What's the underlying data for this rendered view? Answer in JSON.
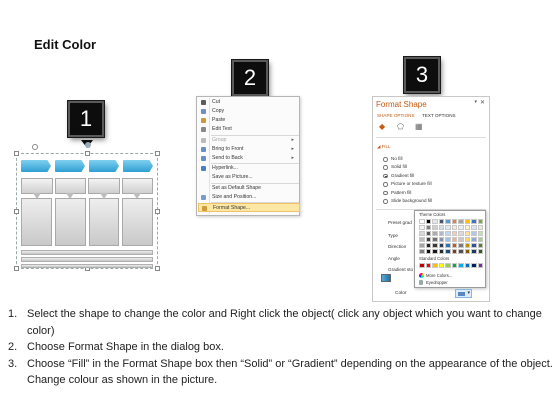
{
  "title": "Edit Color",
  "badges": [
    "1",
    "2",
    "3"
  ],
  "context_menu": {
    "items": [
      {
        "label": "Cut",
        "state": "normal",
        "icon": "scissors-icon",
        "color": "#5b5b5b"
      },
      {
        "label": "Copy",
        "state": "normal",
        "icon": "copy-icon",
        "color": "#6f8fbf"
      },
      {
        "label": "Paste",
        "state": "normal",
        "icon": "paste-icon",
        "color": "#c79a3a"
      },
      {
        "label": "Edit Text",
        "state": "normal",
        "icon": "edit-text-icon",
        "color": "#888888"
      },
      {
        "label": "Group",
        "state": "disabled",
        "icon": "group-icon",
        "color": "#bbbbbb",
        "submenu": true
      },
      {
        "label": "Bring to Front",
        "state": "normal",
        "icon": "bring-front-icon",
        "color": "#6a8fc8",
        "submenu": true
      },
      {
        "label": "Send to Back",
        "state": "normal",
        "icon": "send-back-icon",
        "color": "#6a8fc8",
        "submenu": true
      },
      {
        "label": "Hyperlink...",
        "state": "normal",
        "icon": "hyperlink-icon",
        "color": "#4a7fc0"
      },
      {
        "label": "Save as Picture...",
        "state": "normal",
        "icon": "",
        "color": ""
      },
      {
        "label": "Set as Default Shape",
        "state": "normal",
        "icon": "",
        "color": ""
      },
      {
        "label": "Size and Position...",
        "state": "normal",
        "icon": "size-position-icon",
        "color": "#7c9cc9"
      },
      {
        "label": "Format Shape...",
        "state": "active",
        "icon": "format-shape-icon",
        "color": "#d09b3a"
      }
    ]
  },
  "format_shape": {
    "title": "Format Shape",
    "tabs": [
      "SHAPE OPTIONS",
      "TEXT OPTIONS"
    ],
    "section": "FILL",
    "fill_options": [
      {
        "label": "No fill",
        "checked": false
      },
      {
        "label": "Solid fill",
        "checked": false
      },
      {
        "label": "Gradient fill",
        "checked": true
      },
      {
        "label": "Picture or texture fill",
        "checked": false
      },
      {
        "label": "Pattern fill",
        "checked": false
      },
      {
        "label": "Slide background fill",
        "checked": false
      }
    ],
    "props": [
      "Preset grad",
      "Type",
      "Direction",
      "Angle",
      "Gradient sto"
    ],
    "color_label": "Color"
  },
  "palette": {
    "theme_label": "Theme Colors",
    "standard_label": "Standard Colors",
    "more_colors": "More Colors...",
    "eyedropper": "Eyedropper",
    "theme_top": [
      "#ffffff",
      "#000000",
      "#e7e6e6",
      "#44546a",
      "#5b9bd5",
      "#ed7d31",
      "#a5a5a5",
      "#ffc000",
      "#4472c4",
      "#70ad47"
    ],
    "theme_shades": [
      [
        "#f2f2f2",
        "#7f7f7f",
        "#d0cece",
        "#d6dce4",
        "#deebf6",
        "#fbe5d5",
        "#ededed",
        "#fff2cc",
        "#dae3f3",
        "#e2efd9"
      ],
      [
        "#d8d8d8",
        "#595959",
        "#aeabab",
        "#adb9ca",
        "#bdd7ee",
        "#f7cbac",
        "#dbdbdb",
        "#fee599",
        "#b4c6e7",
        "#c5e0b3"
      ],
      [
        "#bfbfbf",
        "#3f3f3f",
        "#757070",
        "#8496b0",
        "#9cc3e5",
        "#f4b183",
        "#c9c9c9",
        "#ffd966",
        "#8eaadb",
        "#a8d08d"
      ],
      [
        "#a5a5a5",
        "#262626",
        "#3a3838",
        "#323f4f",
        "#2e75b5",
        "#c55a11",
        "#7b7b7b",
        "#bf9000",
        "#2f5496",
        "#538135"
      ],
      [
        "#7f7f7f",
        "#0c0c0c",
        "#171616",
        "#222a35",
        "#1e4e79",
        "#833c0b",
        "#525252",
        "#7f6000",
        "#1f3864",
        "#375623"
      ]
    ],
    "standard": [
      "#c00000",
      "#ff0000",
      "#ffc000",
      "#ffff00",
      "#92d050",
      "#00b050",
      "#00b0f0",
      "#0070c0",
      "#002060",
      "#7030a0"
    ]
  },
  "steps": [
    {
      "num": "1.",
      "text": "Select the shape to change the color and Right click the object( click any object which you want to change color)"
    },
    {
      "num": "2.",
      "text": "Choose Format Shape in the dialog box."
    },
    {
      "num": "3.",
      "text": "Choose “Fill” in the Format Shape box then “Solid” or “Gradient” depending on the appearance of the object. Change colour as shown in the picture."
    }
  ]
}
